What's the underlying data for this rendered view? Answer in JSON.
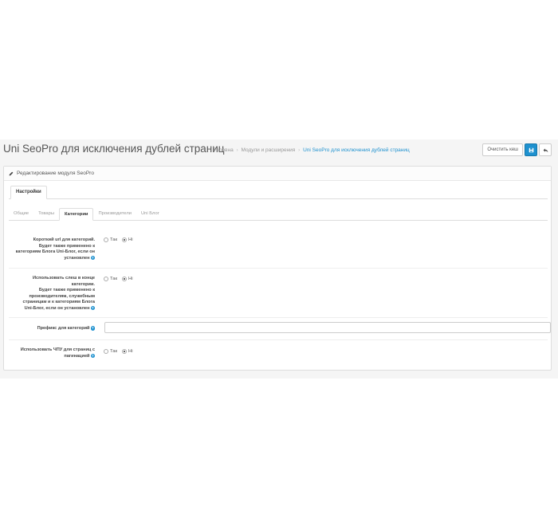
{
  "header": {
    "title": "Uni SeoPro для исключения дублей страниц",
    "breadcrumb": [
      "Головна",
      "Модули и расширения",
      "Uni SeoPro для исключения дублей страниц"
    ],
    "buttons": {
      "clear_cache": "Очистить кеш"
    }
  },
  "panel": {
    "heading": "Редактирование модуля SeoPro",
    "outer_tab": "Настройки",
    "inner_tabs": [
      "Общие",
      "Товары",
      "Категории",
      "Производители",
      "Uni Блог"
    ],
    "active_inner_tab": "Категории"
  },
  "form": {
    "rows": [
      {
        "label_lines": [
          "Короткий url для категорий.",
          "Будет также применено к",
          "категориям Блога Uni-Блог, если он",
          "установлен"
        ],
        "radio_yes": "Так",
        "radio_no": "Ні",
        "selected": "Ні"
      },
      {
        "label_lines": [
          "Использовать слеш в конце",
          "категории.",
          "Будет также применено к",
          "производителям, служебным",
          "страницам и к категориям Блога",
          "Uni-Блог, если он установлен"
        ],
        "radio_yes": "Так",
        "radio_no": "Ні",
        "selected": "Ні"
      },
      {
        "label_lines": [
          "Префикс для категорий"
        ],
        "input_value": ""
      },
      {
        "label_lines": [
          "Использовать ЧПУ для страниц с",
          "пагинацией"
        ],
        "radio_yes": "Так",
        "radio_no": "Ні",
        "selected": "Ні"
      }
    ]
  },
  "colors": {
    "primary": "#1e91cf",
    "page_bg": "#f5f5f5"
  },
  "icons": {
    "save": "save-icon",
    "back": "reply-icon",
    "edit": "pencil-icon",
    "help": "question-circle-icon"
  }
}
